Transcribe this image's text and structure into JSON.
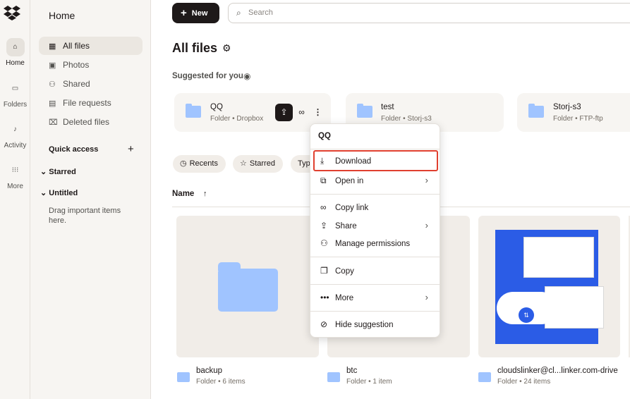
{
  "rail": {
    "items": [
      {
        "label": "Home",
        "icon": "home-icon"
      },
      {
        "label": "Folders",
        "icon": "folders-icon"
      },
      {
        "label": "Activity",
        "icon": "bell-icon"
      },
      {
        "label": "More",
        "icon": "grid-icon"
      }
    ]
  },
  "sidebar": {
    "title": "Home",
    "items": [
      {
        "label": "All files",
        "icon": "all-files-icon"
      },
      {
        "label": "Photos",
        "icon": "photos-icon"
      },
      {
        "label": "Shared",
        "icon": "shared-icon"
      },
      {
        "label": "File requests",
        "icon": "file-requests-icon"
      },
      {
        "label": "Deleted files",
        "icon": "trash-icon"
      }
    ],
    "quick_access": "Quick access",
    "starred": "Starred",
    "untitled": "Untitled",
    "hint": "Drag important items here."
  },
  "toolbar": {
    "new_label": "New",
    "search_placeholder": "Search"
  },
  "main": {
    "title": "All files",
    "suggested_label": "Suggested for you",
    "suggestions": [
      {
        "name": "QQ",
        "sub": "Folder • Dropbox"
      },
      {
        "name": "test",
        "sub": "Folder • Storj-s3"
      },
      {
        "name": "Storj-s3",
        "sub": "Folder • FTP-ftp"
      }
    ],
    "chips": [
      {
        "label": "Recents",
        "icon": "clock-icon"
      },
      {
        "label": "Starred",
        "icon": "star-icon"
      },
      {
        "label": "Typ",
        "icon": ""
      }
    ],
    "column_name": "Name",
    "files": [
      {
        "name": "backup",
        "sub": "Folder • 6 items"
      },
      {
        "name": "btc",
        "sub": "Folder • 1 item"
      },
      {
        "name": "cloudslinker@cl...linker.com-drive",
        "sub": "Folder • 24 items"
      }
    ]
  },
  "context_menu": {
    "title": "QQ",
    "items": [
      {
        "label": "Download",
        "icon": "download-icon",
        "submenu": false
      },
      {
        "label": "Open in",
        "icon": "open-in-icon",
        "submenu": true
      },
      {
        "label": "Copy link",
        "icon": "link-icon",
        "submenu": false
      },
      {
        "label": "Share",
        "icon": "share-icon",
        "submenu": true
      },
      {
        "label": "Manage permissions",
        "icon": "permissions-icon",
        "submenu": false
      },
      {
        "label": "Copy",
        "icon": "copy-icon",
        "submenu": false
      },
      {
        "label": "More",
        "icon": "more-icon",
        "submenu": true
      },
      {
        "label": "Hide suggestion",
        "icon": "hide-icon",
        "submenu": false
      }
    ]
  },
  "colors": {
    "accent": "#1e1919",
    "folder": "#a0c4ff",
    "highlight": "#e0402f"
  }
}
